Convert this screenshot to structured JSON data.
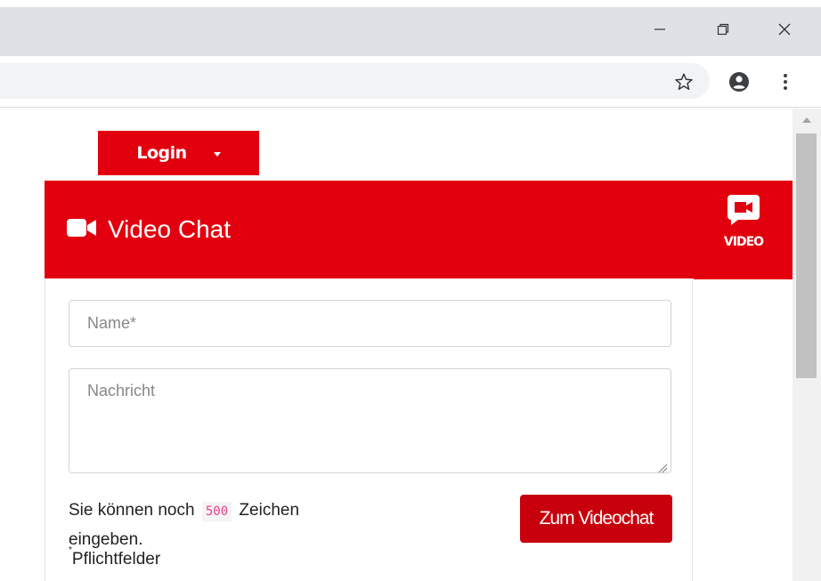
{
  "window": {
    "minimize_icon": "minimize-icon",
    "restore_icon": "restore-icon",
    "close_icon": "close-icon"
  },
  "toolbar": {
    "bookmark_icon": "star-icon",
    "profile_icon": "profile-icon",
    "menu_icon": "menu-dots-icon"
  },
  "page": {
    "login_label": "Login",
    "banner_title": "Video Chat",
    "video_tab_label": "VIDEO",
    "form": {
      "name_placeholder": "Name*",
      "message_placeholder": "Nachricht",
      "hint_before": "Sie können noch",
      "char_count": "500",
      "hint_after": "Zeichen",
      "hint_line2": "eingeben.",
      "required_star": "*",
      "required_label": "Pflichtfelder",
      "submit_label": "Zum Videochat"
    }
  },
  "colors": {
    "brand_red": "#e2000f",
    "button_red": "#c8000d",
    "chrome_gray": "#dee1e6"
  }
}
